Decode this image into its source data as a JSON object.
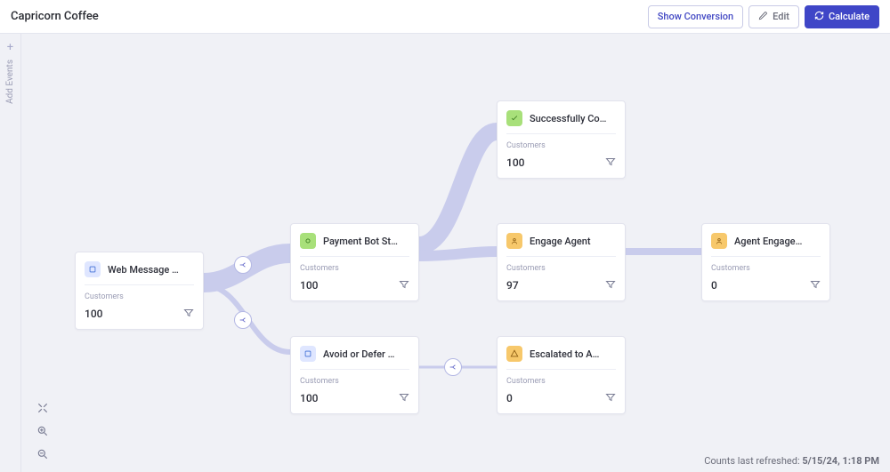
{
  "header": {
    "title": "Capricorn Coffee",
    "show_conversion": "Show Conversion",
    "edit": "Edit",
    "calculate": "Calculate"
  },
  "sidebar": {
    "add_events": "Add Events"
  },
  "footer": {
    "refreshed_label": "Counts last refreshed:",
    "refreshed_time": "5/15/24, 1:18 PM"
  },
  "metric_label": "Customers",
  "nodes": {
    "web_message": {
      "title": "Web Message …",
      "value": "100",
      "icon": "blue"
    },
    "payment_bot": {
      "title": "Payment Bot St…",
      "value": "100",
      "icon": "green"
    },
    "avoid_defer": {
      "title": "Avoid or Defer …",
      "value": "100",
      "icon": "blue"
    },
    "success": {
      "title": "Successfully Co…",
      "value": "100",
      "icon": "green"
    },
    "engage_agent": {
      "title": "Engage Agent",
      "value": "97",
      "icon": "orange"
    },
    "escalated": {
      "title": "Escalated to A…",
      "value": "0",
      "icon": "orange"
    },
    "agent_engage": {
      "title": "Agent Engage…",
      "value": "0",
      "icon": "orange"
    }
  }
}
